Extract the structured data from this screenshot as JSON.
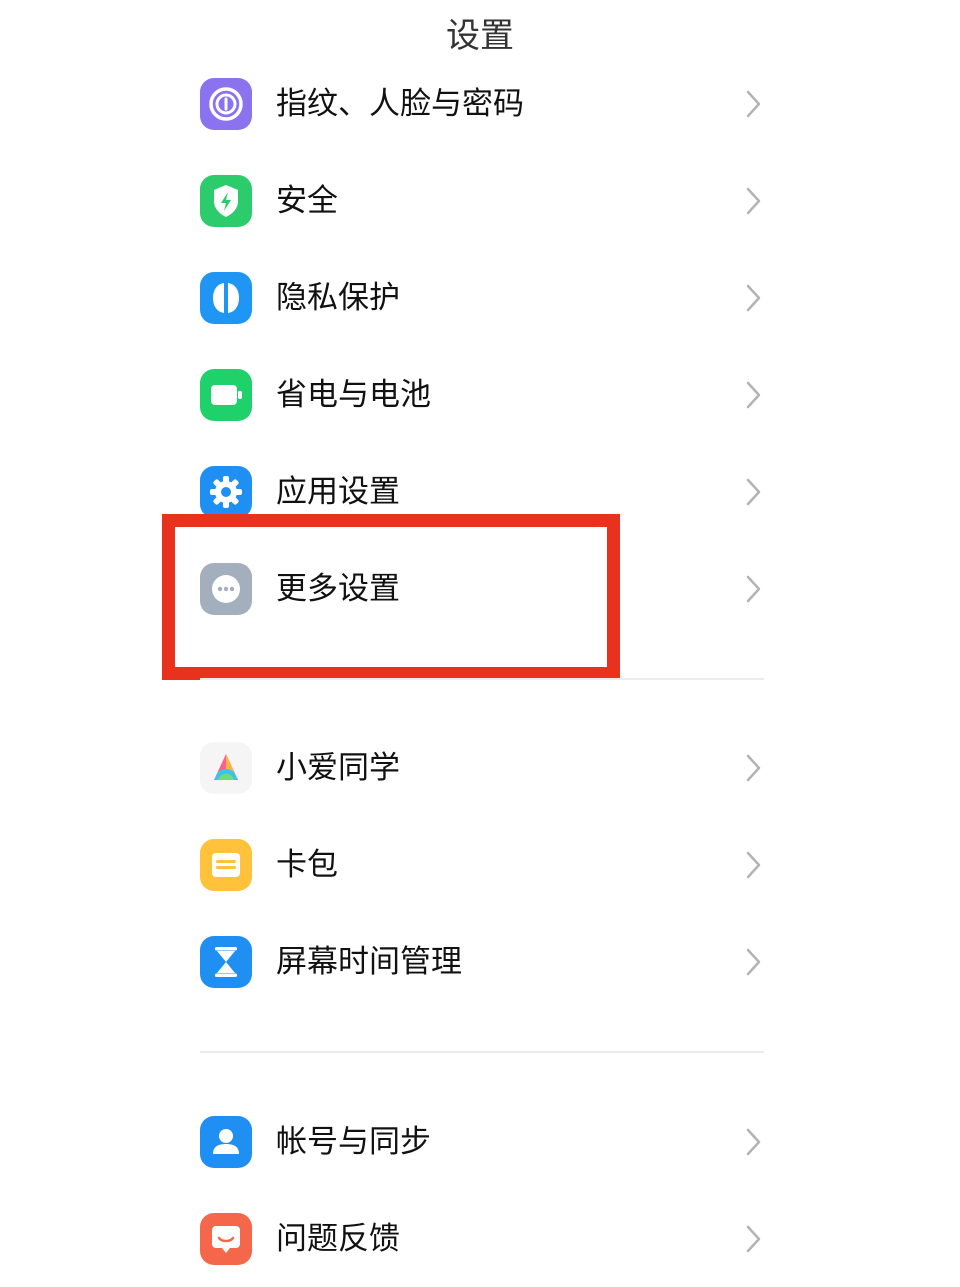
{
  "header": {
    "title": "设置"
  },
  "group1": {
    "items": [
      {
        "label": "指纹、人脸与密码",
        "icon": "fingerprint-icon",
        "color": "#8b73f0"
      },
      {
        "label": "安全",
        "icon": "shield-icon",
        "color": "#2ccb6b"
      },
      {
        "label": "隐私保护",
        "icon": "privacy-icon",
        "color": "#1f96f3"
      },
      {
        "label": "省电与电池",
        "icon": "battery-icon",
        "color": "#1fd16b"
      },
      {
        "label": "应用设置",
        "icon": "gear-icon",
        "color": "#1f8ff3"
      },
      {
        "label": "更多设置",
        "icon": "more-icon",
        "color": "#a4afbd"
      }
    ]
  },
  "group2": {
    "items": [
      {
        "label": "小爱同学",
        "icon": "xiaoai-icon",
        "color": "#f5f5f5"
      },
      {
        "label": "卡包",
        "icon": "wallet-icon",
        "color": "#ffc23a"
      },
      {
        "label": "屏幕时间管理",
        "icon": "hourglass-icon",
        "color": "#1f8ff3"
      }
    ]
  },
  "group3": {
    "items": [
      {
        "label": "帐号与同步",
        "icon": "account-icon",
        "color": "#1f8ff3"
      },
      {
        "label": "问题反馈",
        "icon": "feedback-icon",
        "color": "#f5674a"
      }
    ]
  },
  "annotation": {
    "highlight_color": "#e8321e"
  }
}
